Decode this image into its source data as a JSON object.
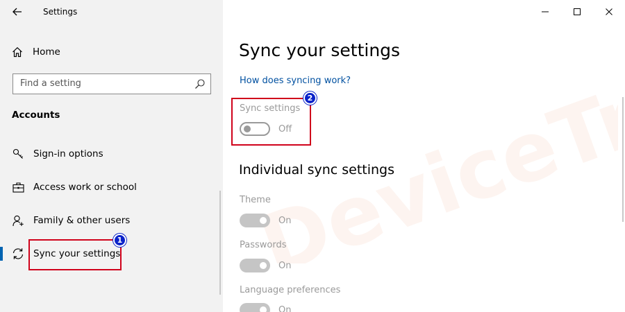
{
  "window": {
    "title": "Settings",
    "controls": [
      "minimize",
      "maximize",
      "close"
    ]
  },
  "sidebar": {
    "home_label": "Home",
    "search_placeholder": "Find a setting",
    "section": "Accounts",
    "items": [
      {
        "label": "Sign-in options",
        "icon": "key-icon"
      },
      {
        "label": "Access work or school",
        "icon": "briefcase-icon"
      },
      {
        "label": "Family & other users",
        "icon": "person-add-icon"
      },
      {
        "label": "Sync your settings",
        "icon": "sync-icon",
        "active": true
      }
    ]
  },
  "main": {
    "title": "Sync your settings",
    "help_link": "How does syncing work?",
    "sync_settings": {
      "label": "Sync settings",
      "state": "Off"
    },
    "individual_title": "Individual sync settings",
    "individual": [
      {
        "label": "Theme",
        "state": "On"
      },
      {
        "label": "Passwords",
        "state": "On"
      },
      {
        "label": "Language preferences",
        "state": "On"
      }
    ]
  },
  "annotations": {
    "badge_1": "1",
    "badge_2": "2",
    "annotation_color": "#d0021b",
    "badge_color": "#0a22c9"
  },
  "watermark_text": "DeviceTricks",
  "colors": {
    "sidebar_bg": "#f2f2f2",
    "accent": "#0063b1",
    "link": "#0050a0",
    "disabled": "#9a9a9a"
  }
}
